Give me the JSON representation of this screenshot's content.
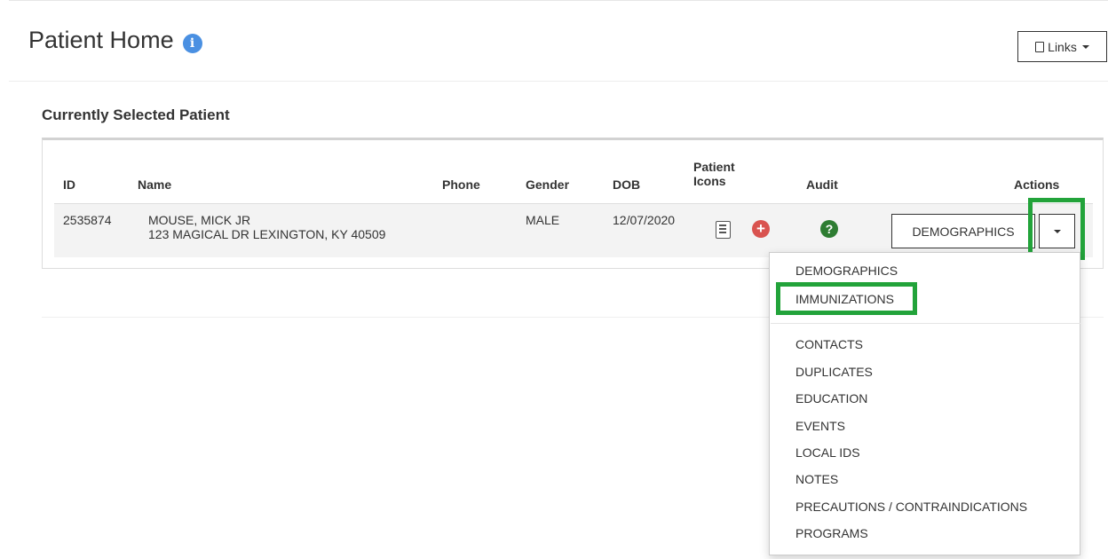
{
  "page": {
    "title": "Patient Home",
    "info_icon": "i",
    "links_label": "Links"
  },
  "section": {
    "title": "Currently Selected Patient"
  },
  "table": {
    "headers": {
      "id": "ID",
      "name": "Name",
      "phone": "Phone",
      "gender": "Gender",
      "dob": "DOB",
      "patient_icons_line1": "Patient",
      "patient_icons_line2": "Icons",
      "audit": "Audit",
      "actions": "Actions"
    },
    "rows": [
      {
        "id": "2535874",
        "name": "MOUSE, MICK JR",
        "address": "123 MAGICAL DR LEXINGTON, KY 40509",
        "phone": "",
        "gender": "MALE",
        "dob": "12/07/2020",
        "plus_icon": "+",
        "audit_icon": "?",
        "action_label": "DEMOGRAPHICS"
      }
    ]
  },
  "dropdown": {
    "items": [
      "DEMOGRAPHICS",
      "IMMUNIZATIONS",
      "CONTACTS",
      "DUPLICATES",
      "EDUCATION",
      "EVENTS",
      "LOCAL IDS",
      "NOTES",
      "PRECAUTIONS / CONTRAINDICATIONS",
      "PROGRAMS"
    ]
  },
  "colors": {
    "highlight": "#22a33a",
    "info_blue": "#4a90e2",
    "alert_red": "#d9534f",
    "audit_green": "#2e7d32"
  },
  "icons": {
    "info": "info-icon",
    "links": "document-icon",
    "patient_chart": "chart-icon",
    "patient_alert": "plus-circle-icon",
    "audit": "question-circle-icon",
    "toggle": "caret-down-icon"
  }
}
